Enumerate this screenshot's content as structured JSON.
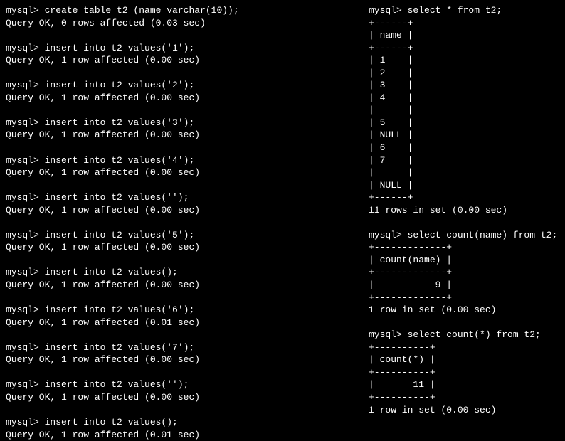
{
  "prompt": "mysql>",
  "left": {
    "cmds": [
      {
        "sql": "create table t2 (name varchar(10));",
        "result": "Query OK, 0 rows affected (0.03 sec)"
      },
      {
        "sql": "insert into t2 values('1');",
        "result": "Query OK, 1 row affected (0.00 sec)"
      },
      {
        "sql": "insert into t2 values('2');",
        "result": "Query OK, 1 row affected (0.00 sec)"
      },
      {
        "sql": "insert into t2 values('3');",
        "result": "Query OK, 1 row affected (0.00 sec)"
      },
      {
        "sql": "insert into t2 values('4');",
        "result": "Query OK, 1 row affected (0.00 sec)"
      },
      {
        "sql": "insert into t2 values('');",
        "result": "Query OK, 1 row affected (0.00 sec)"
      },
      {
        "sql": "insert into t2 values('5');",
        "result": "Query OK, 1 row affected (0.00 sec)"
      },
      {
        "sql": "insert into t2 values();",
        "result": "Query OK, 1 row affected (0.00 sec)"
      },
      {
        "sql": "insert into t2 values('6');",
        "result": "Query OK, 1 row affected (0.01 sec)"
      },
      {
        "sql": "insert into t2 values('7');",
        "result": "Query OK, 1 row affected (0.00 sec)"
      },
      {
        "sql": "insert into t2 values('');",
        "result": "Query OK, 1 row affected (0.00 sec)"
      },
      {
        "sql": "insert into t2 values();",
        "result": "Query OK, 1 row affected (0.01 sec)"
      }
    ]
  },
  "right": {
    "q1": {
      "sql": "select * from t2;",
      "header": "name",
      "rows": [
        "1",
        "2",
        "3",
        "4",
        "",
        "5",
        "NULL",
        "6",
        "7",
        "",
        "NULL"
      ],
      "footer": "11 rows in set (0.00 sec)"
    },
    "q2": {
      "sql": "select count(name) from t2;",
      "header": "count(name)",
      "value": "9",
      "footer": "1 row in set (0.00 sec)"
    },
    "q3": {
      "sql": "select count(*) from t2;",
      "header": "count(*)",
      "value": "11",
      "footer": "1 row in set (0.00 sec)"
    }
  }
}
